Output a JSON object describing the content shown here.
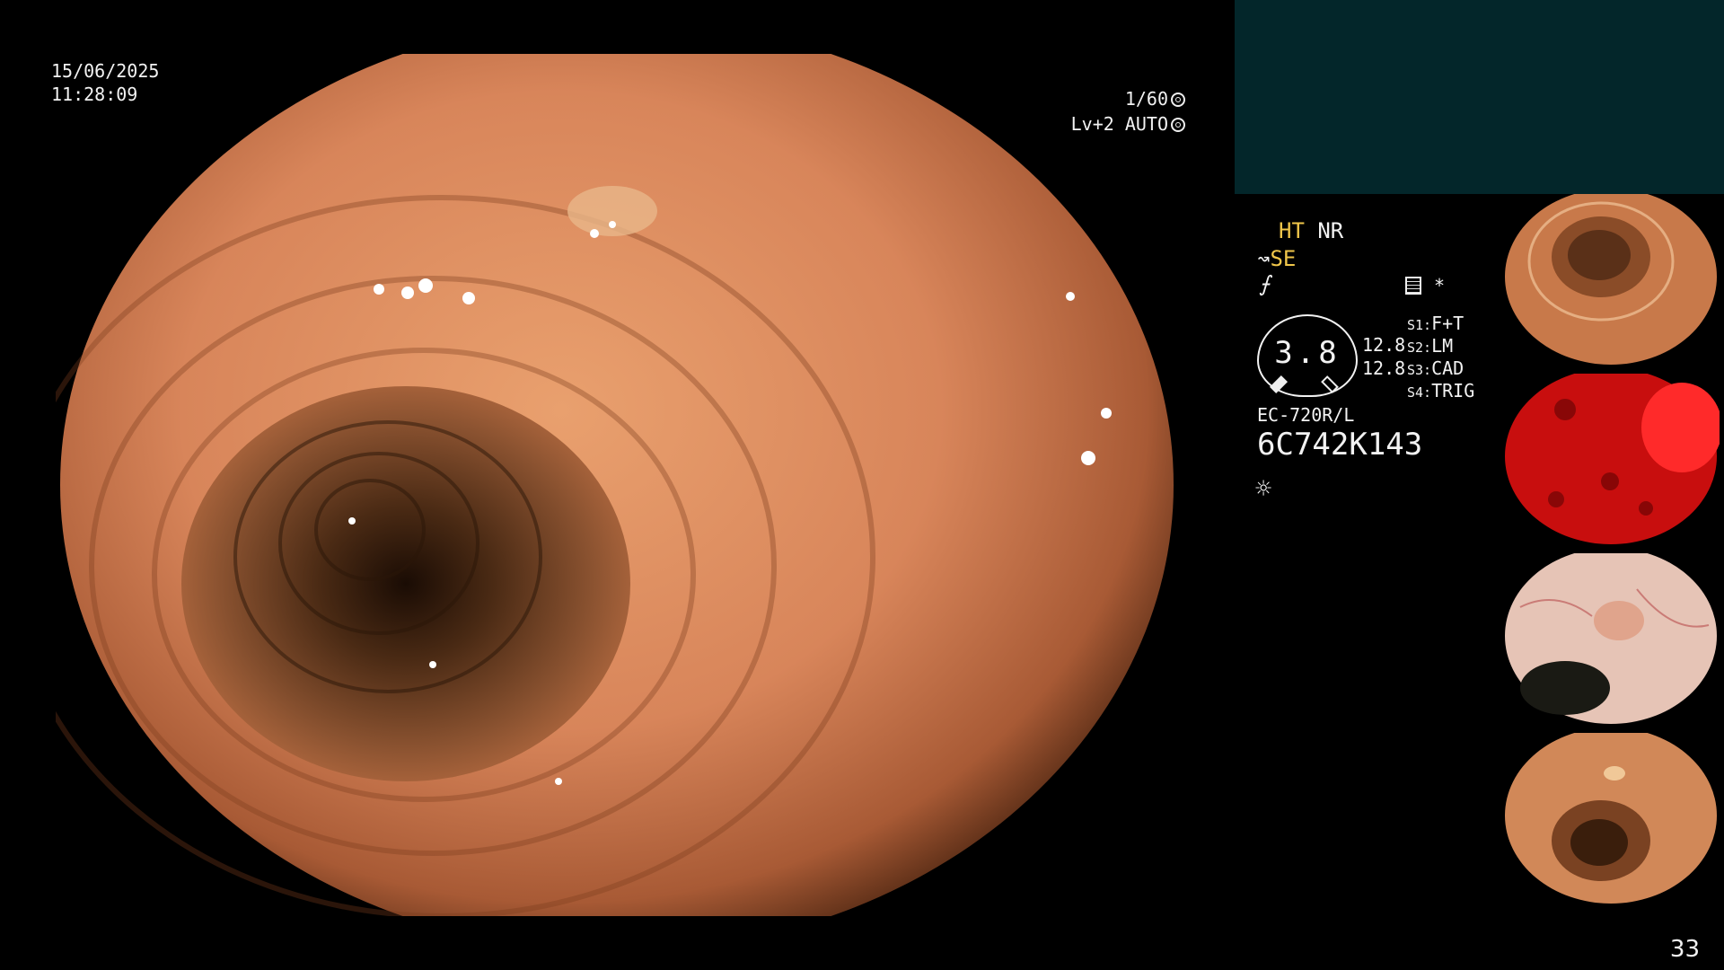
{
  "main_overlay": {
    "date": "15/06/2025",
    "time": "11:28:09",
    "shutter": "1/60",
    "shutter_icon": "shutter-icon",
    "level": "Lv+2 AUTO",
    "level_icon": "auto-iris-icon"
  },
  "status_panel": {
    "ht": "HT",
    "nr": "NR",
    "se": "SE",
    "se_icon": "structure-enhance-icon",
    "f_symbol": "⨍",
    "star": "*",
    "doc_icon": "record-icon",
    "gauge_value": "3.8",
    "value_a": "12.8",
    "value_b": "12.8",
    "switches": [
      {
        "key": "S1:",
        "value": "F+T"
      },
      {
        "key": "S2:",
        "value": "LM"
      },
      {
        "key": "S3:",
        "value": "CAD"
      },
      {
        "key": "S4:",
        "value": "TRIG"
      }
    ],
    "scope_model": "EC-720R/L",
    "scope_serial": "6C742K143",
    "light_icon": "light-source-icon"
  },
  "thumbnails": [
    {
      "name": "colon-lumen-thumbnail"
    },
    {
      "name": "red-view-thumbnail"
    },
    {
      "name": "polyp-closeup-thumbnail"
    },
    {
      "name": "colon-folds-thumbnail"
    }
  ],
  "page_number": "33",
  "colors": {
    "background": "#000000",
    "teal_panel": "#03262a",
    "highlight_yellow": "#f0c64a",
    "text": "#f2f2f2"
  }
}
